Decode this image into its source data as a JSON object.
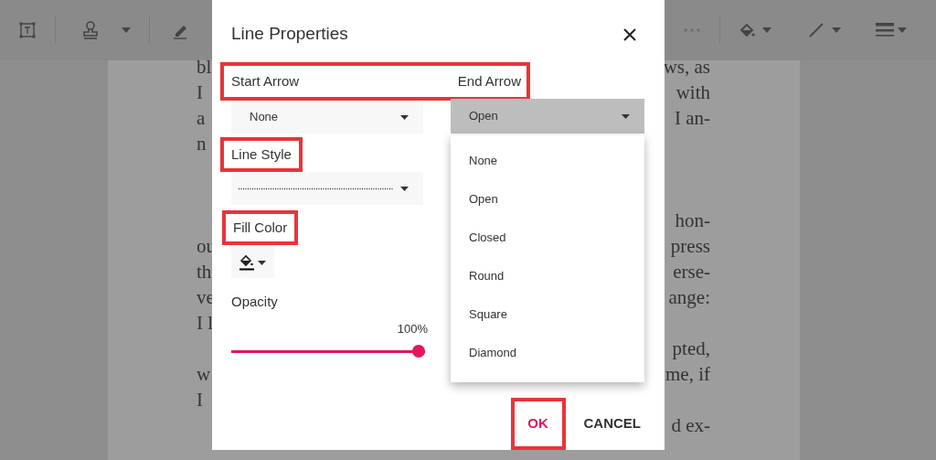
{
  "document": {
    "lines": [
      {
        "kind": "text",
        "left": "bl",
        "right": "ws, as"
      },
      {
        "kind": "text",
        "left": "I",
        "right": "with"
      },
      {
        "kind": "text",
        "left": "a",
        "right": "I an-"
      },
      {
        "kind": "text",
        "left": "n"
      },
      {
        "kind": "blank"
      },
      {
        "kind": "blank"
      },
      {
        "kind": "text",
        "right": "hon-"
      },
      {
        "kind": "text",
        "left": "ou",
        "right": "press"
      },
      {
        "kind": "text",
        "left": "th",
        "right": "erse-"
      },
      {
        "kind": "text",
        "left": "ve",
        "right": "ange:"
      },
      {
        "kind": "text",
        "left": "I l"
      },
      {
        "kind": "text",
        "right": "pted,"
      },
      {
        "kind": "text",
        "left": "w",
        "right": "me, if"
      },
      {
        "kind": "text",
        "left": "I"
      },
      {
        "kind": "text",
        "right": "d ex-"
      }
    ]
  },
  "dialog": {
    "title": "Line Properties",
    "arrows": {
      "highlighted": true,
      "start": {
        "label": "Start Arrow",
        "value": "None",
        "expanded": false
      },
      "end": {
        "label": "End Arrow",
        "value": "Open",
        "expanded": true,
        "options": [
          "None",
          "Open",
          "Closed",
          "Round",
          "Square",
          "Diamond"
        ]
      }
    },
    "line_style": {
      "label": "Line Style",
      "highlighted": true
    },
    "fill_color": {
      "label": "Fill Color",
      "highlighted": true,
      "color": "#000000"
    },
    "opacity": {
      "label": "Opacity",
      "reading": "100%",
      "level": 1
    },
    "buttons": [
      {
        "label": "OK",
        "kind": "primary",
        "highlighted": true
      },
      {
        "label": "CANCEL",
        "kind": "secondary",
        "highlighted": false
      }
    ]
  }
}
